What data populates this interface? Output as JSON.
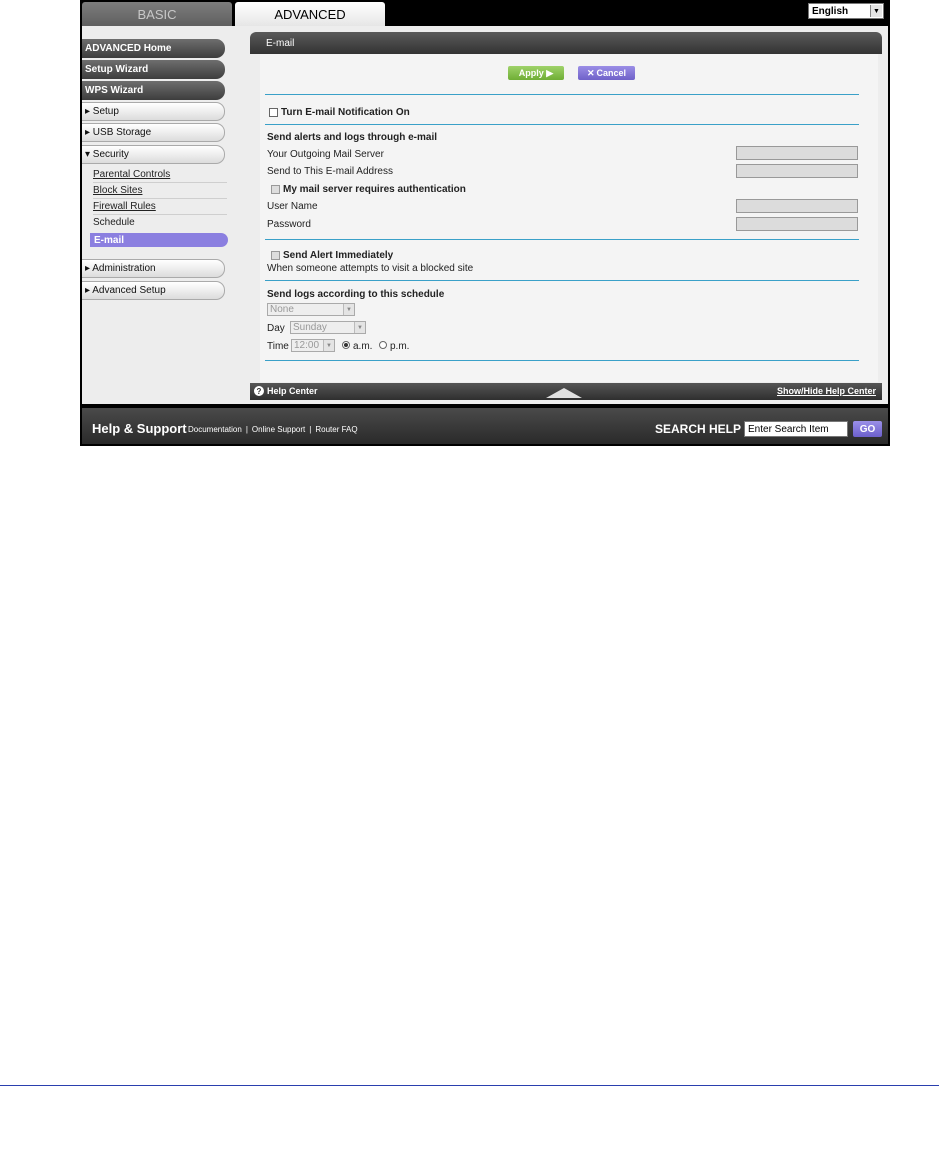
{
  "tabs": {
    "basic": "BASIC",
    "advanced": "ADVANCED"
  },
  "language": {
    "selected": "English"
  },
  "sidebar": {
    "advanced_home": "ADVANCED Home",
    "setup_wizard": "Setup Wizard",
    "wps_wizard": "WPS Wizard",
    "setup": "▸ Setup",
    "usb_storage": "▸ USB Storage",
    "security": "▾ Security",
    "security_items": [
      "Parental Controls",
      "Block Sites",
      "Firewall Rules",
      "Schedule"
    ],
    "email_active": "E-mail",
    "administration": "▸ Administration",
    "advanced_setup": "▸ Advanced Setup"
  },
  "panel": {
    "title": "E-mail",
    "apply": "Apply ▶",
    "cancel": "Cancel",
    "turn_on": "Turn E-mail Notification On",
    "send_alerts_heading": "Send alerts and logs through e-mail",
    "outgoing_server": "Your Outgoing Mail Server",
    "send_to": "Send to This E-mail Address",
    "auth_required": "My mail server requires authentication",
    "user_name": "User Name",
    "password": "Password",
    "send_alert_immediately": "Send Alert Immediately",
    "when_blocked": "When someone attempts to visit a blocked site",
    "schedule_heading": "Send logs according to this schedule",
    "schedule_value": "None",
    "day_label": "Day",
    "day_value": "Sunday",
    "time_label": "Time",
    "time_value": "12:00",
    "am": "a.m.",
    "pm": "p.m."
  },
  "helpbar": {
    "help_center": "Help Center",
    "show_hide": "Show/Hide Help Center"
  },
  "footer": {
    "help_support": "Help & Support",
    "links": [
      "Documentation",
      "Online Support",
      "Router FAQ"
    ],
    "search_label": "SEARCH HELP",
    "search_value": "Enter Search Item",
    "go": "GO"
  }
}
